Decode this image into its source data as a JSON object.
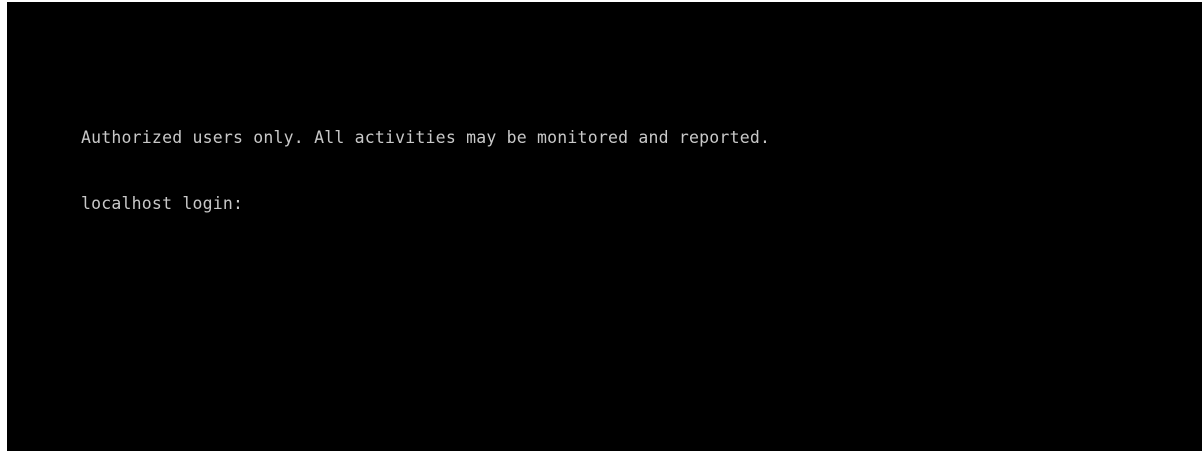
{
  "terminal": {
    "banner": "Authorized users only. All activities may be monitored and reported.",
    "login_prompt": "localhost login:",
    "login_value": "",
    "colors": {
      "background": "#000000",
      "text": "#c8c8c8",
      "frame": "#ffffff"
    }
  }
}
